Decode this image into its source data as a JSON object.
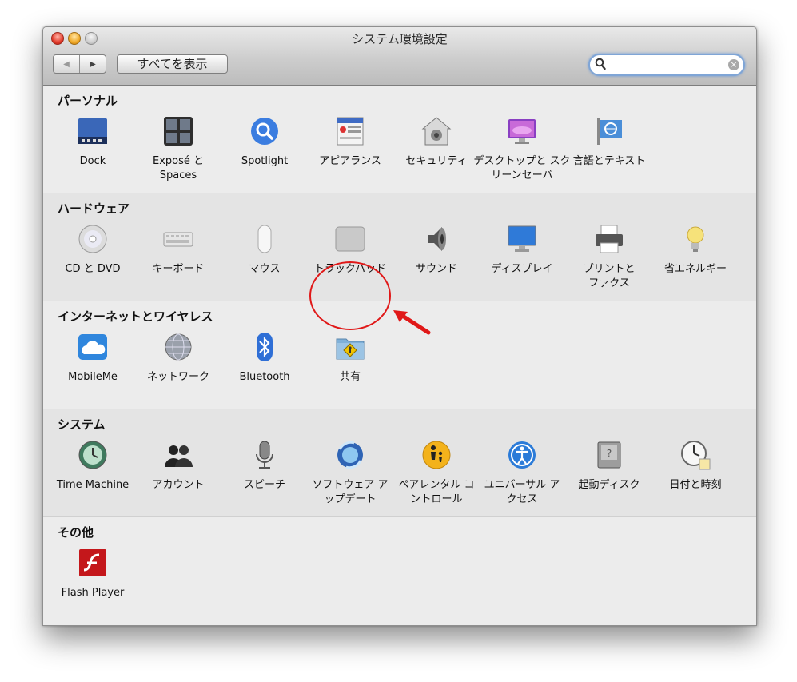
{
  "window": {
    "title": "システム環境設定",
    "show_all_label": "すべてを表示",
    "nav_back_icon": "◀",
    "nav_forward_icon": "▶",
    "search": {
      "value": "",
      "placeholder": ""
    }
  },
  "sections": [
    {
      "title": "パーソナル",
      "items": [
        {
          "label": "Dock",
          "icon": "dock-icon"
        },
        {
          "label": "Exposé と Spaces",
          "icon": "expose-spaces-icon"
        },
        {
          "label": "Spotlight",
          "icon": "spotlight-icon"
        },
        {
          "label": "アピアランス",
          "icon": "appearance-icon"
        },
        {
          "label": "セキュリティ",
          "icon": "security-icon"
        },
        {
          "label": "デスクトップと スクリーンセーバ",
          "icon": "desktop-screensaver-icon"
        },
        {
          "label": "言語とテキスト",
          "icon": "language-text-icon"
        }
      ]
    },
    {
      "title": "ハードウェア",
      "items": [
        {
          "label": "CD と DVD",
          "icon": "cd-dvd-icon"
        },
        {
          "label": "キーボード",
          "icon": "keyboard-icon"
        },
        {
          "label": "マウス",
          "icon": "mouse-icon"
        },
        {
          "label": "トラックパッド",
          "icon": "trackpad-icon"
        },
        {
          "label": "サウンド",
          "icon": "speaker-icon"
        },
        {
          "label": "ディスプレイ",
          "icon": "display-icon"
        },
        {
          "label": "プリントと ファクス",
          "icon": "printer-icon"
        },
        {
          "label": "省エネルギー",
          "icon": "lightbulb-icon"
        }
      ]
    },
    {
      "title": "インターネットとワイヤレス",
      "items": [
        {
          "label": "MobileMe",
          "icon": "cloud-icon"
        },
        {
          "label": "ネットワーク",
          "icon": "network-globe-icon"
        },
        {
          "label": "Bluetooth",
          "icon": "bluetooth-icon"
        },
        {
          "label": "共有",
          "icon": "sharing-folder-icon"
        }
      ]
    },
    {
      "title": "システム",
      "items": [
        {
          "label": "Time Machine",
          "icon": "time-machine-icon"
        },
        {
          "label": "アカウント",
          "icon": "accounts-icon"
        },
        {
          "label": "スピーチ",
          "icon": "microphone-icon"
        },
        {
          "label": "ソフトウェア アップデート",
          "icon": "software-update-icon"
        },
        {
          "label": "ペアレンタル コントロール",
          "icon": "parental-controls-icon"
        },
        {
          "label": "ユニバーサル アクセス",
          "icon": "universal-access-icon"
        },
        {
          "label": "起動ディスク",
          "icon": "startup-disk-icon"
        },
        {
          "label": "日付と時刻",
          "icon": "date-time-icon"
        }
      ]
    },
    {
      "title": "その他",
      "items": [
        {
          "label": "Flash Player",
          "icon": "flash-player-icon"
        }
      ]
    }
  ],
  "annotation": {
    "highlighted_item": "共有",
    "color": "#e01818"
  }
}
